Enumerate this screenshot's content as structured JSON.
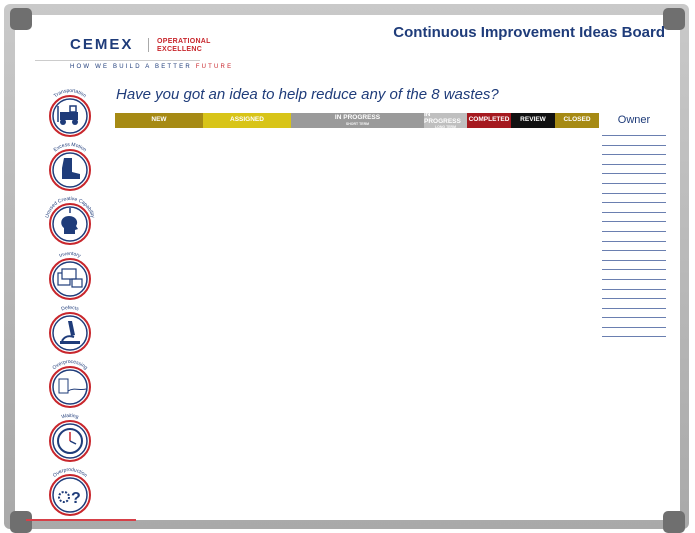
{
  "brand": {
    "logo_text": "CEMEX",
    "opex_line1": "OPERATIONAL",
    "opex_line2": "EXCELLENC",
    "tagline_main": "HOW WE BUILD A BETTER",
    "tagline_accent": "FUTURE"
  },
  "board_title": "Continuous Improvement Ideas Board",
  "question": "Have you got an idea to help reduce any of the 8 wastes?",
  "columns": [
    {
      "label": "NEW",
      "sub": "",
      "color": "#a68a14"
    },
    {
      "label": "ASSIGNED",
      "sub": "",
      "color": "#d8c418"
    },
    {
      "label": "IN PROGRESS",
      "sub": "SHORT TERM",
      "color": "#9a9a9a"
    },
    {
      "label": "IN PROGRESS",
      "sub": "LONG TERM",
      "color": "#bfbfbf"
    },
    {
      "label": "COMPLETED",
      "sub": "",
      "color": "#a5191f"
    },
    {
      "label": "REVIEW",
      "sub": "",
      "color": "#111111"
    },
    {
      "label": "CLOSED",
      "sub": "",
      "color": "#a68a14"
    }
  ],
  "owner_header": "Owner",
  "wastes": [
    {
      "label": "Transportation",
      "icon": "forklift-icon"
    },
    {
      "label": "Excess Motion",
      "icon": "boot-icon"
    },
    {
      "label": "Unused Creative Capability",
      "icon": "head-idea-icon"
    },
    {
      "label": "Inventory",
      "icon": "boxes-icon"
    },
    {
      "label": "Defects",
      "icon": "microscope-icon"
    },
    {
      "label": "Overprocessing",
      "icon": "cement-spill-icon"
    },
    {
      "label": "Waiting",
      "icon": "clock-icon"
    },
    {
      "label": "Overproduction",
      "icon": "gears-question-icon"
    }
  ],
  "colors": {
    "navy": "#1f3c7a",
    "red": "#c8262c"
  }
}
